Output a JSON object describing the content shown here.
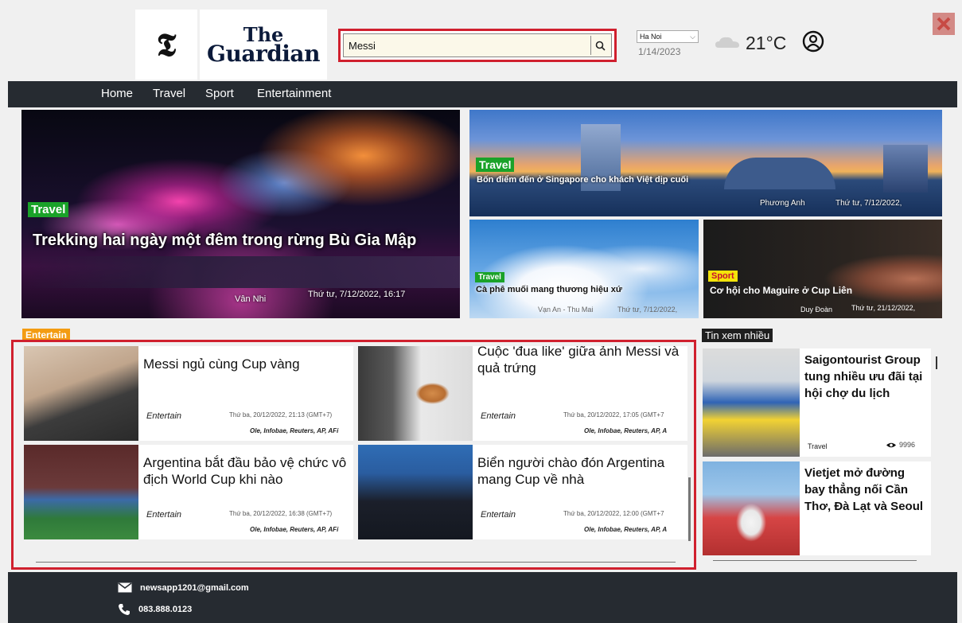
{
  "header": {
    "logo_mark": "𝕿",
    "logo_line1": "The",
    "logo_line2": "Guardian",
    "search_value": "Messi",
    "city": "Ha Noi",
    "date": "1/14/2023",
    "temperature": "21°C"
  },
  "nav": [
    "Home",
    "Travel",
    "Sport",
    "Entertainment"
  ],
  "hero": {
    "main": {
      "tag": "Travel",
      "title": "Trekking hai ngày một đêm trong rừng Bù Gia Mập",
      "author": "Vân Nhi",
      "time": "Thứ tư, 7/12/2022, 16:17"
    },
    "sg": {
      "tag": "Travel",
      "title": "Bốn điểm đến ở Singapore cho khách Việt dịp cuối",
      "author": "Phương Anh",
      "time": "Thứ tư, 7/12/2022,"
    },
    "cafe": {
      "tag": "Travel",
      "title": "Cà phê muối mang thương hiệu xứ",
      "author": "Vạn An - Thu Mai",
      "time": "Thứ tư, 7/12/2022,"
    },
    "sport": {
      "tag": "Sport",
      "title": "Cơ hội cho Maguire ở Cup Liên",
      "author": "Duy Đoàn",
      "time": "Thứ tư, 21/12/2022,"
    }
  },
  "entertain": {
    "section_label": "Entertain",
    "cards": [
      {
        "title": "Messi ngủ cùng Cup vàng",
        "category": "Entertain",
        "time": "Thứ ba, 20/12/2022, 21:13 (GMT+7)",
        "sources": "Ole, Infobae, Reuters, AP, AFi"
      },
      {
        "title": "Cuộc 'đua like' giữa ảnh Messi và quả trứng",
        "category": "Entertain",
        "time": "Thứ ba, 20/12/2022, 17:05 (GMT+7",
        "sources": "Ole, Infobae, Reuters, AP, A"
      },
      {
        "title": "Argentina bắt đầu bảo vệ chức vô địch World Cup khi nào",
        "category": "Entertain",
        "time": "Thứ ba, 20/12/2022, 16:38 (GMT+7)",
        "sources": "Ole, Infobae, Reuters, AP, AFi"
      },
      {
        "title": "Biển người chào đón Argentina mang Cup về nhà",
        "category": "Entertain",
        "time": "Thứ ba, 20/12/2022, 12:00 (GMT+7",
        "sources": "Ole, Infobae, Reuters, AP, A"
      }
    ]
  },
  "sidebar": {
    "label": "Tin xem nhiều",
    "items": [
      {
        "title": "Saigontourist Group tung nhiều ưu đãi tại hội chợ du lịch",
        "category": "Travel",
        "views": "9996"
      },
      {
        "title": "Vietjet mở đường bay thẳng nối Cần Thơ, Đà Lạt và Seoul"
      }
    ]
  },
  "footer": {
    "email": "newsapp1201@gmail.com",
    "phone": "083.888.0123"
  }
}
